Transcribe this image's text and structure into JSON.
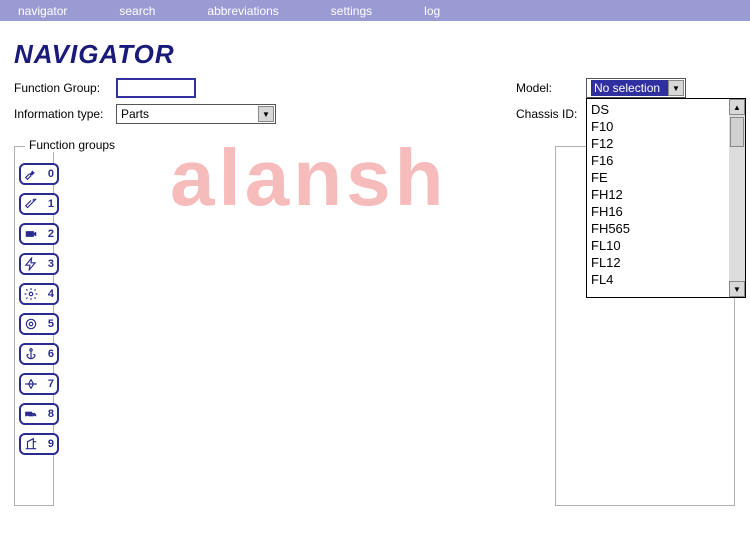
{
  "topnav": {
    "items": [
      "navigator",
      "search",
      "abbreviations",
      "settings",
      "log"
    ]
  },
  "title": "NAVIGATOR",
  "filters": {
    "function_group_label": "Function Group:",
    "function_group_value": "",
    "info_type_label": "Information type:",
    "info_type_value": "Parts",
    "model_label": "Model:",
    "model_value": "No selection",
    "chassis_label": "Chassis ID:",
    "chassis_value": "",
    "model_options": [
      "DS",
      "F10",
      "F12",
      "F16",
      "FE",
      "FH12",
      "FH16",
      "FH565",
      "FL10",
      "FL12",
      "FL4"
    ]
  },
  "groups_label": "Function groups",
  "right_label": ":",
  "icons": [
    {
      "name": "wrench-icon",
      "num": "0"
    },
    {
      "name": "spanner-icon",
      "num": "1"
    },
    {
      "name": "camera-icon",
      "num": "2"
    },
    {
      "name": "lightning-icon",
      "num": "3"
    },
    {
      "name": "gear-icon",
      "num": "4"
    },
    {
      "name": "disc-icon",
      "num": "5"
    },
    {
      "name": "anchor-icon",
      "num": "6"
    },
    {
      "name": "plane-icon",
      "num": "7"
    },
    {
      "name": "truck-icon",
      "num": "8"
    },
    {
      "name": "crane-icon",
      "num": "9"
    }
  ],
  "watermark": "alansh"
}
